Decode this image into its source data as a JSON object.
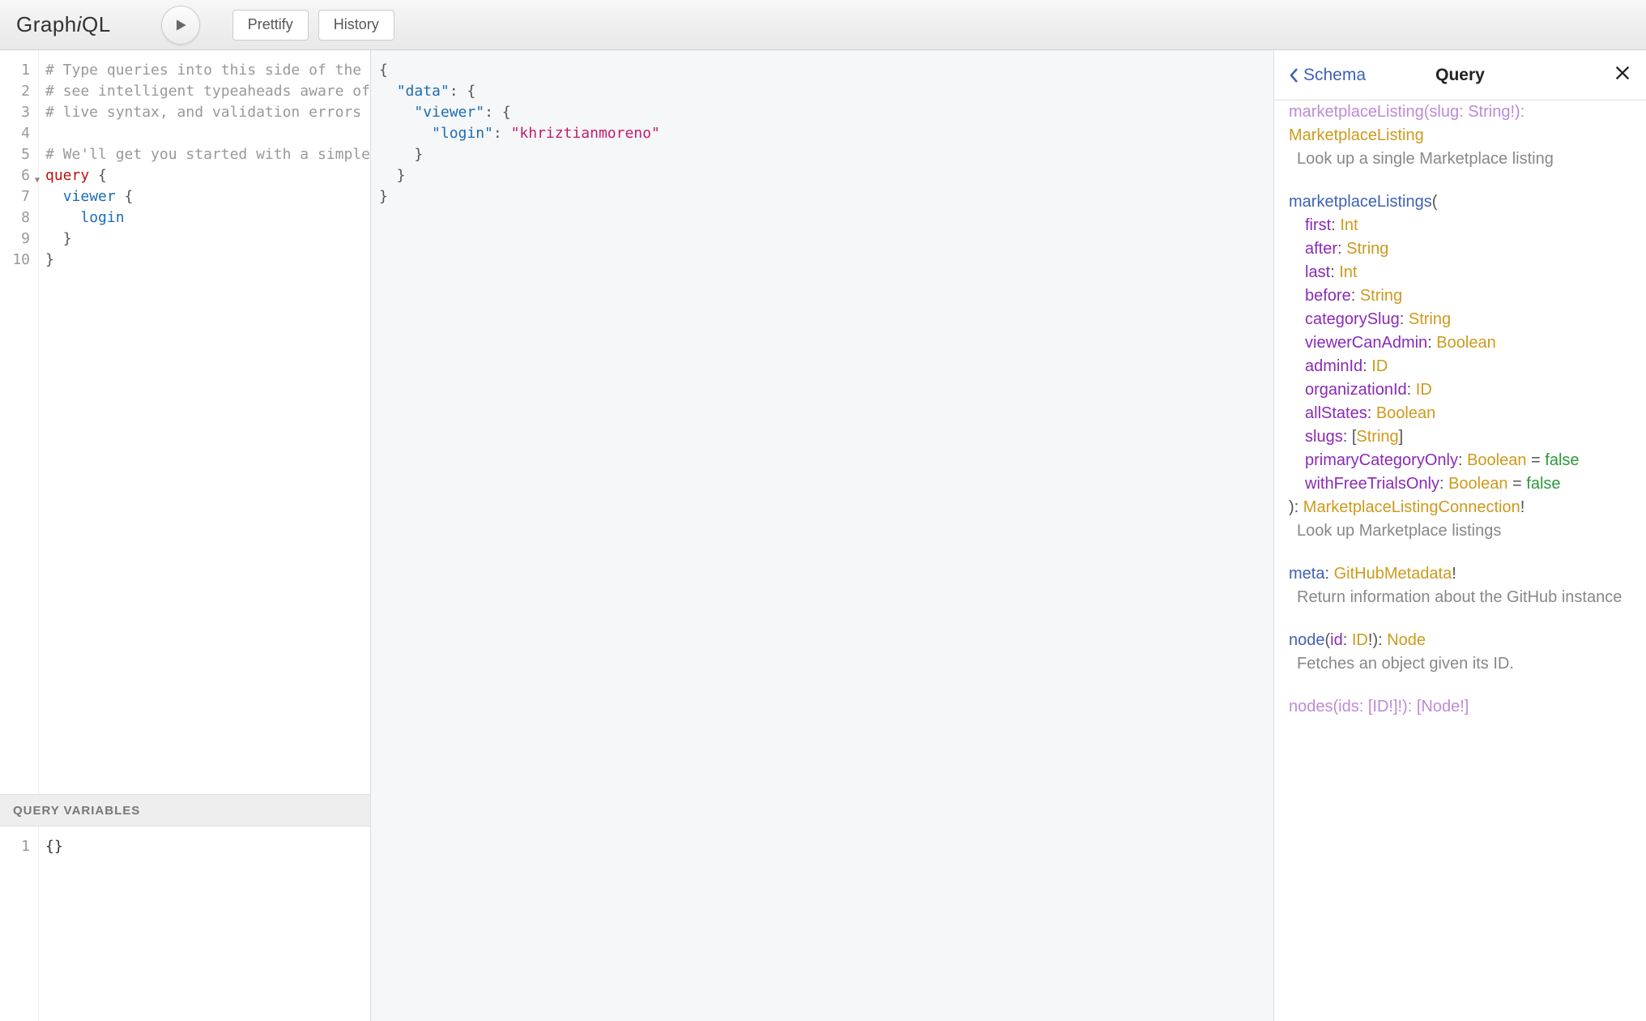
{
  "toolbar": {
    "logo_plain1": "Graph",
    "logo_italic": "i",
    "logo_plain2": "QL",
    "prettify": "Prettify",
    "history": "History"
  },
  "editor": {
    "lines": [
      "1",
      "2",
      "3",
      "4",
      "5",
      "6",
      "7",
      "8",
      "9",
      "10"
    ],
    "comment1": "# Type queries into this side of the scre",
    "comment2": "# see intelligent typeaheads aware of the",
    "comment3": "# live syntax, and validation errors high",
    "blank": "",
    "comment4": "# We'll get you started with a simple que",
    "kw_query": "query",
    "brace_open": " {",
    "viewer": "viewer",
    "login": "login",
    "brace_close": "}",
    "vars_label": "QUERY VARIABLES",
    "vars_content": "{}"
  },
  "result": {
    "l1": "{",
    "l2_key": "\"data\"",
    "l2_rest": ": {",
    "l3_key": "\"viewer\"",
    "l3_rest": ": {",
    "l4_key": "\"login\"",
    "l4_mid": ": ",
    "l4_val": "\"khriztianmoreno\"",
    "l5": "    }",
    "l6": "  }",
    "l7": "}"
  },
  "docs": {
    "back": "Schema",
    "title": "Query",
    "cutoff_top": "marketplaceListing(slug: String!):",
    "block1": {
      "type": "MarketplaceListing",
      "desc": "Look up a single Marketplace listing"
    },
    "listings": {
      "name": "marketplaceListings",
      "args": [
        {
          "name": "first",
          "type": "Int"
        },
        {
          "name": "after",
          "type": "String"
        },
        {
          "name": "last",
          "type": "Int"
        },
        {
          "name": "before",
          "type": "String"
        },
        {
          "name": "categorySlug",
          "type": "String"
        },
        {
          "name": "viewerCanAdmin",
          "type": "Boolean"
        },
        {
          "name": "adminId",
          "type": "ID"
        },
        {
          "name": "organizationId",
          "type": "ID"
        },
        {
          "name": "allStates",
          "type": "Boolean"
        },
        {
          "name": "slugs",
          "type": "[String]",
          "wrap": true
        },
        {
          "name": "primaryCategoryOnly",
          "type": "Boolean",
          "default": "false"
        },
        {
          "name": "withFreeTrialsOnly",
          "type": "Boolean",
          "default": "false"
        }
      ],
      "ret": "MarketplaceListingConnection",
      "bang": "!",
      "desc": "Look up Marketplace listings"
    },
    "meta": {
      "name": "meta",
      "type": "GitHubMetadata",
      "bang": "!",
      "desc": "Return information about the GitHub instance"
    },
    "node": {
      "name": "node",
      "arg": "id",
      "argtype": "ID",
      "bang": "!",
      "ret": "Node",
      "desc": "Fetches an object given its ID."
    },
    "cutoff_bottom": "nodes(ids: [ID!]!): [Node!]"
  }
}
